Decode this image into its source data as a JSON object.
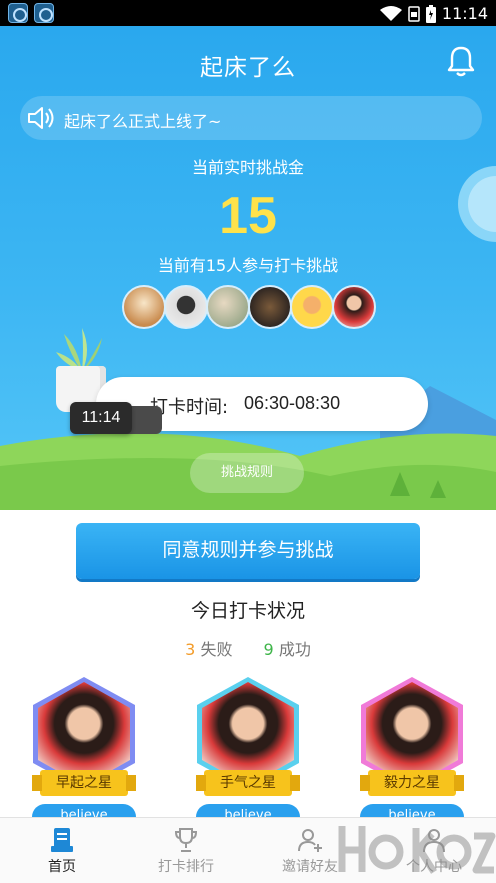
{
  "status_bar": {
    "time": "11:14",
    "app_icons": [
      "app-icon",
      "app-icon"
    ],
    "icons": [
      "wifi-icon",
      "sim-icon",
      "battery-icon"
    ]
  },
  "header": {
    "title": "起床了么",
    "bell_icon": "bell-icon"
  },
  "notice": {
    "icon": "speaker-icon",
    "text": "起床了么正式上线了~"
  },
  "prize": {
    "label": "当前实时挑战金",
    "value": "15"
  },
  "participants_text": "当前有15人参与打卡挑战",
  "avatars": [
    "avatar",
    "avatar",
    "avatar",
    "avatar",
    "avatar",
    "avatar"
  ],
  "punch": {
    "label": "打卡时间:",
    "value": "06:30-08:30",
    "clock": "11:14"
  },
  "rules_button": "挑战规则",
  "join_button": "同意规则并参与挑战",
  "today": {
    "title": "今日打卡状况",
    "fail_count": "3",
    "fail_label": "失败",
    "success_count": "9",
    "success_label": "成功"
  },
  "stars": [
    {
      "title": "早起之星",
      "name": "believe",
      "border": "#7f8cf2"
    },
    {
      "title": "手气之星",
      "name": "believe",
      "border": "#5ad0ee"
    },
    {
      "title": "毅力之星",
      "name": "believe",
      "border": "#f07ad8"
    }
  ],
  "tabs": [
    {
      "label": "首页",
      "icon": "home-icon",
      "active": true
    },
    {
      "label": "打卡排行",
      "icon": "trophy-icon",
      "active": false
    },
    {
      "label": "邀请好友",
      "icon": "add-friend-icon",
      "active": false
    },
    {
      "label": "个人中心",
      "icon": "user-icon",
      "active": false
    }
  ],
  "colors": {
    "primary": "#2aa8ee",
    "prize": "#ffe24a",
    "fail": "#f39c2a",
    "success": "#3fb54a",
    "ribbon": "#f7c31c"
  }
}
